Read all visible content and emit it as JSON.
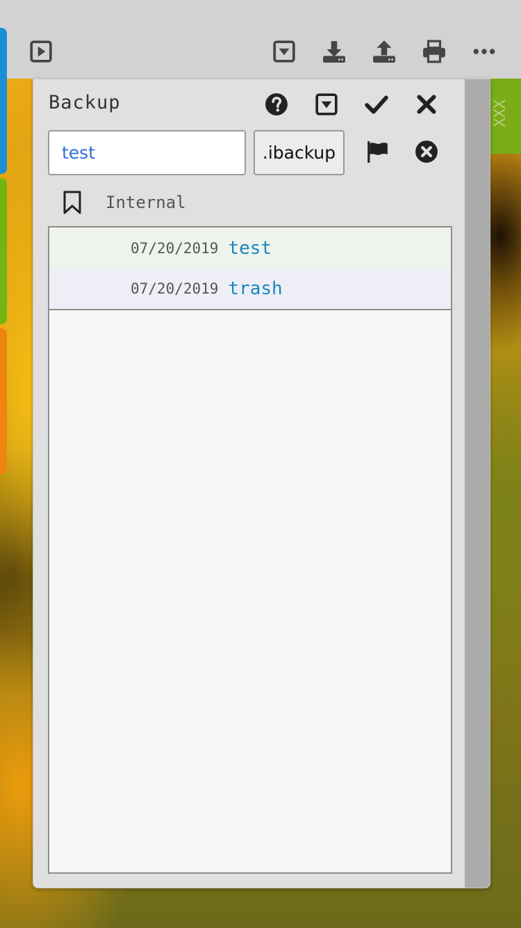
{
  "toolbar": {
    "icons": [
      "play-square-icon",
      "dropdown-square-icon",
      "download-icon",
      "upload-icon",
      "print-icon",
      "more-icon"
    ]
  },
  "side_strip": {
    "text": "XXX"
  },
  "panel": {
    "title": "Backup",
    "header_icons": [
      "help-icon",
      "dropdown-square-icon",
      "check-icon",
      "close-icon"
    ],
    "filename_input": {
      "value": "test",
      "placeholder": ""
    },
    "extension_label": ".ibackup",
    "flag_icon": "flag-icon",
    "clear_icon": "clear-circle-icon",
    "storage": {
      "icon": "bookmark-icon",
      "label": "Internal"
    },
    "files": [
      {
        "date": "07/20/2019",
        "name": "test"
      },
      {
        "date": "07/20/2019",
        "name": "trash"
      }
    ]
  },
  "colors": {
    "toolbar_bg": "#d2d2d2",
    "panel_bg": "#e0e0e0",
    "list_bg": "#f6f6f6",
    "file_name": "#1a86c0",
    "input_text": "#2d6de0",
    "tab_blue": "#1a8fd6",
    "tab_green": "#72b512",
    "tab_orange": "#ef8411"
  }
}
